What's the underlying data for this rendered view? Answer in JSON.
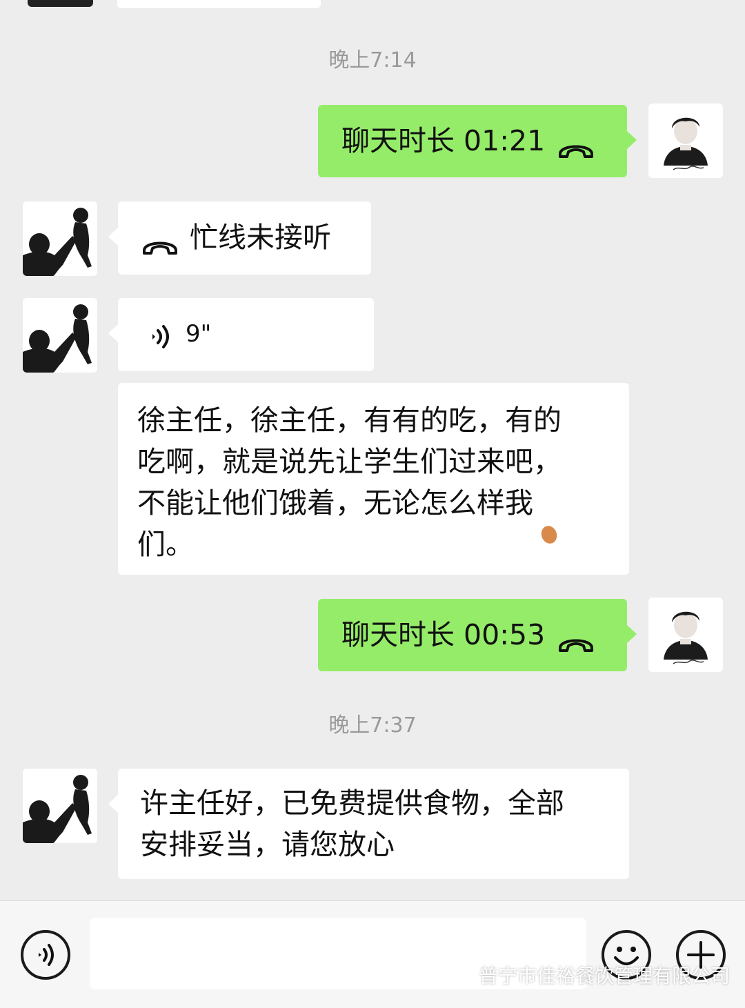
{
  "timestamps": [
    "晚上7:14",
    "晚上7:37"
  ],
  "messages": {
    "call1": {
      "text": "聊天时长 01:21",
      "direction": "outgoing"
    },
    "missed": {
      "text": "忙线未接听",
      "direction": "incoming"
    },
    "voice": {
      "duration": "9\"",
      "direction": "incoming"
    },
    "text1": {
      "lines": [
        "徐主任，徐主任，有有的吃，有的",
        "吃啊，就是说先让学生们过来吧，",
        "不能让他们饿着，无论怎么样我",
        "们。"
      ],
      "direction": "incoming"
    },
    "call2": {
      "text": "聊天时长 00:53",
      "direction": "outgoing"
    },
    "text2": {
      "lines": [
        "许主任好，已免费提供食物，全部",
        "安排妥当，请您放心"
      ],
      "direction": "incoming"
    }
  },
  "watermark": "普宁市佳裕餐饮管理有限公司",
  "colors": {
    "background": "#ededed",
    "outgoing_bubble": "#95ec69",
    "incoming_bubble": "#ffffff",
    "timestamp": "#9a9a9a"
  },
  "icons": {
    "call": "phone-handset-icon",
    "voice": "voice-wave-icon",
    "emoji": "smiley-icon",
    "plus": "plus-icon",
    "voice_input": "voice-input-icon"
  }
}
